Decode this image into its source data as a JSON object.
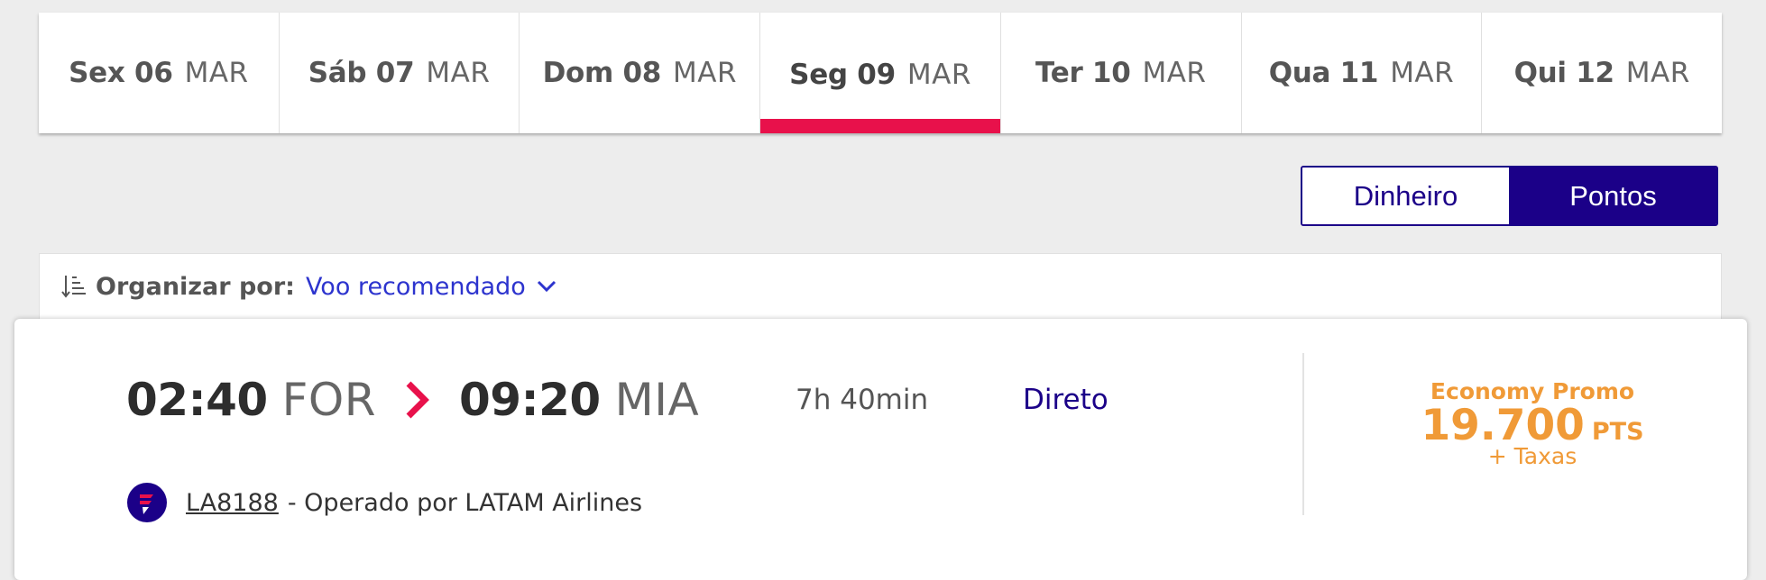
{
  "date_tabs": [
    {
      "day": "Sex 06",
      "month": "MAR"
    },
    {
      "day": "Sáb 07",
      "month": "MAR"
    },
    {
      "day": "Dom 08",
      "month": "MAR"
    },
    {
      "day": "Seg 09",
      "month": "MAR"
    },
    {
      "day": "Ter 10",
      "month": "MAR"
    },
    {
      "day": "Qua 11",
      "month": "MAR"
    },
    {
      "day": "Qui 12",
      "month": "MAR"
    }
  ],
  "toggle": {
    "cash_label": "Dinheiro",
    "points_label": "Pontos"
  },
  "sort": {
    "label": "Organizar por:",
    "value": "Voo recomendado"
  },
  "flight": {
    "departure_time": "02:40",
    "origin": "FOR",
    "arrival_time": "09:20",
    "destination": "MIA",
    "duration": "7h 40min",
    "stops": "Direto",
    "flight_number": "LA8188",
    "operator": "- Operado por LATAM Airlines",
    "fare_class": "Economy Promo",
    "price": "19.700",
    "price_unit": "PTS",
    "taxes": "+ Taxas"
  },
  "colors": {
    "brand_blue": "#1b0088",
    "accent_red": "#e8114b",
    "fare_orange": "#f09a37",
    "link_blue": "#2d34ce"
  },
  "icons": {
    "sort": "sort-icon",
    "chevron": "chevron-down-icon",
    "arrow": "chevron-right-icon",
    "airline": "latam-logo-icon"
  }
}
